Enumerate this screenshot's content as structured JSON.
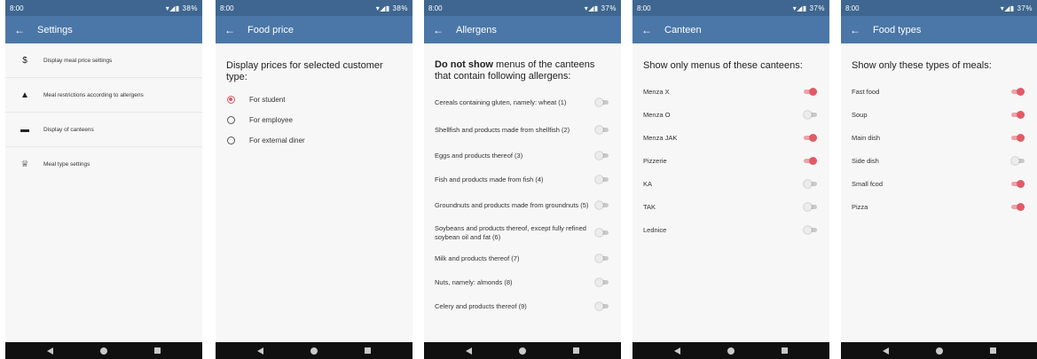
{
  "status_time": "8:00",
  "colors": {
    "primary": "#4a77a8",
    "status_bar": "#3e6690",
    "accent": "#e05b66"
  },
  "screens": {
    "settings": {
      "battery": "38%",
      "title": "Settings",
      "items": [
        {
          "icon": "dollar-icon",
          "label": "Display meal price settings"
        },
        {
          "icon": "warning-icon",
          "label": "Meal restrictions according to allergens"
        },
        {
          "icon": "store-icon",
          "label": "Display of canteens"
        },
        {
          "icon": "chef-hat-icon",
          "label": "Meal type settings"
        }
      ]
    },
    "food_price": {
      "battery": "38%",
      "title": "Food price",
      "heading": "Display prices for selected customer type:",
      "options": [
        {
          "label": "For student",
          "checked": true
        },
        {
          "label": "For employee",
          "checked": false
        },
        {
          "label": "For external diner",
          "checked": false
        }
      ]
    },
    "allergens": {
      "battery": "37%",
      "title": "Allergens",
      "heading_bold": "Do not show",
      "heading_rest": " menus of the canteens that contain following allergens:",
      "items": [
        {
          "label": "Cereals containing gluten, namely: wheat (1)",
          "on": false
        },
        {
          "label": "Shellfish and products made from shellfish (2)",
          "on": false
        },
        {
          "label": "Eggs and products thereof (3)",
          "on": false
        },
        {
          "label": "Fish and products made from fish (4)",
          "on": false
        },
        {
          "label": "Groundnuts and products made from groundnuts (5)",
          "on": false
        },
        {
          "label": "Soybeans and products thereof, except fully refined soybean oil and fat (6)",
          "on": false
        },
        {
          "label": "Milk and products thereof (7)",
          "on": false
        },
        {
          "label": "Nuts, namely: almonds (8)",
          "on": false
        },
        {
          "label": "Celery and products thereof (9)",
          "on": false
        }
      ]
    },
    "canteen": {
      "battery": "37%",
      "title": "Canteen",
      "heading": "Show only menus of these canteens:",
      "items": [
        {
          "label": "Menza X",
          "on": true
        },
        {
          "label": "Menza O",
          "on": false
        },
        {
          "label": "Menza JAK",
          "on": true
        },
        {
          "label": "Pizzerie",
          "on": true
        },
        {
          "label": "KA",
          "on": false
        },
        {
          "label": "TAK",
          "on": false
        },
        {
          "label": "Lednice",
          "on": false
        }
      ]
    },
    "food_types": {
      "battery": "37%",
      "title": "Food types",
      "heading": "Show only these types of meals:",
      "items": [
        {
          "label": "Fast food",
          "on": true
        },
        {
          "label": "Soup",
          "on": true
        },
        {
          "label": "Main dish",
          "on": true
        },
        {
          "label": "Side dish",
          "on": false
        },
        {
          "label": "Small fcod",
          "on": true
        },
        {
          "label": "Pizza",
          "on": true
        }
      ]
    }
  }
}
